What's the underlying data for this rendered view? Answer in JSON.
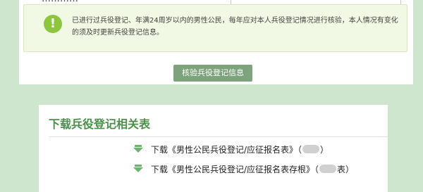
{
  "top_panel": {
    "cut_label": "…………",
    "notice": {
      "icon": "exclamation-icon",
      "text": "已进行过兵役登记、年满24周岁以内的男性公民，每年应对本人兵役登记情况进行核验，本人情况有变化的须及时更新兵役登记信息。"
    },
    "verify_button": "核验兵役登记信息"
  },
  "downloads": {
    "title": "下载兵役登记相关表",
    "items": [
      {
        "prefix": "下载《男性公民兵役登记/应征报名表》（",
        "suffix": "）"
      },
      {
        "prefix": "下载《男性公民兵役登记/应征报名表存根》（",
        "suffix": "表）"
      }
    ]
  },
  "colors": {
    "background": "#cde6cd",
    "notice_bg": "#f1f8e3",
    "icon_green": "#8cc63e",
    "button": "#7da37d",
    "title_green": "#4b8f4b"
  }
}
